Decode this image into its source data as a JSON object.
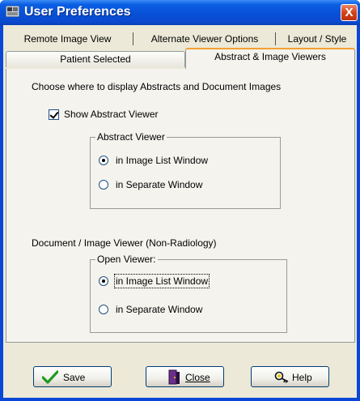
{
  "window": {
    "title": "User Preferences",
    "close_glyph": "X"
  },
  "tabs": {
    "row1": [
      "Remote Image View",
      "Alternate Viewer Options",
      "Layout / Style"
    ],
    "row2": [
      "Patient Selected",
      "Abstract & Image Viewers"
    ],
    "active": "Abstract & Image Viewers"
  },
  "panel": {
    "heading": "Choose where to display Abstracts and Document Images",
    "show_abstract": {
      "label": "Show Abstract Viewer",
      "checked": true
    },
    "abstract_group": {
      "legend": "Abstract Viewer",
      "options": [
        {
          "label": "in Image List Window",
          "selected": true
        },
        {
          "label": "in Separate Window",
          "selected": false
        }
      ]
    },
    "doc_heading": "Document / Image Viewer  (Non-Radiology)",
    "open_group": {
      "legend": "Open Viewer:",
      "options": [
        {
          "label": "in Image List Window",
          "selected": true
        },
        {
          "label": "in Separate Window",
          "selected": false
        }
      ]
    }
  },
  "buttons": {
    "save": "Save",
    "close": "Close",
    "help": "Help"
  },
  "icons": {
    "save": "checkmark-icon",
    "close": "door-exit-icon",
    "help": "help-key-icon",
    "app": "app-window-icon"
  },
  "colors": {
    "title_bar": "#0a5fe4",
    "close_button": "#d5421a",
    "panel_bg": "#f4f3ee",
    "checkmark": "#1e9a1e"
  }
}
